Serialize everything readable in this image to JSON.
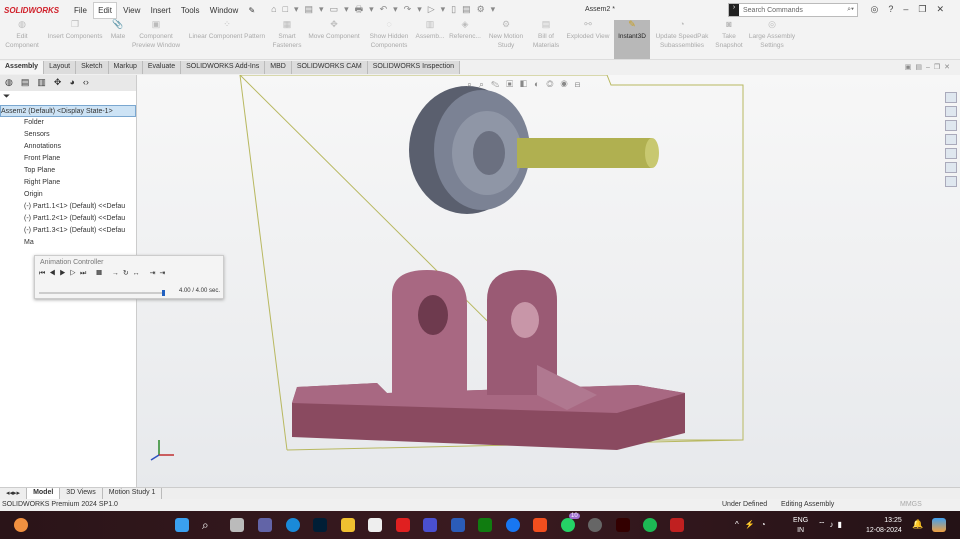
{
  "app": {
    "logo": "SOLIDWORKS",
    "title": "Assem2 *",
    "search_placeholder": "Search Commands"
  },
  "menu": [
    "File",
    "Edit",
    "View",
    "Insert",
    "Tools",
    "Window"
  ],
  "commands": [
    {
      "label": "Edit Component"
    },
    {
      "label": "Insert Components"
    },
    {
      "label": "Mate"
    },
    {
      "label": "Component Preview Window"
    },
    {
      "label": "Linear Component Pattern"
    },
    {
      "label": "Smart Fasteners"
    },
    {
      "label": "Move Component"
    },
    {
      "label": "Show Hidden Components"
    },
    {
      "label": "Assemb..."
    },
    {
      "label": "Referenc..."
    },
    {
      "label": "New Motion Study"
    },
    {
      "label": "Bill of Materials"
    },
    {
      "label": "Exploded View"
    },
    {
      "label": "Instant3D"
    },
    {
      "label": "Update SpeedPak Subassemblies"
    },
    {
      "label": "Take Snapshot"
    },
    {
      "label": "Large Assembly Settings"
    }
  ],
  "tabs": [
    "Assembly",
    "Layout",
    "Sketch",
    "Markup",
    "Evaluate",
    "SOLIDWORKS Add-Ins",
    "MBD",
    "SOLIDWORKS CAM",
    "SOLIDWORKS Inspection"
  ],
  "tree": {
    "root": "Assem2 (Default) <Display State-1>",
    "items": [
      "Folder",
      "Sensors",
      "Annotations",
      "Front Plane",
      "Top Plane",
      "Right Plane",
      "Origin",
      "(-) Part1.1<1> (Default) <<Defau",
      "(-) Part1.2<1> (Default) <<Defau",
      "(-) Part1.3<1> (Default) <<Defau",
      "Ma"
    ]
  },
  "animation": {
    "title": "Animation Controller",
    "time": "4.00 / 4.00 sec.",
    "progress": 1.0
  },
  "bottom_tabs": [
    "Model",
    "3D Views",
    "Motion Study 1"
  ],
  "status": {
    "product": "SOLIDWORKS Premium 2024 SP1.0",
    "state": "Under Defined",
    "mode": "Editing Assembly",
    "units": "MMGS"
  },
  "taskbar": {
    "lang": "ENG",
    "region": "IN",
    "time": "13:25",
    "date": "12-08-2024",
    "whatsapp_badge": "10"
  }
}
